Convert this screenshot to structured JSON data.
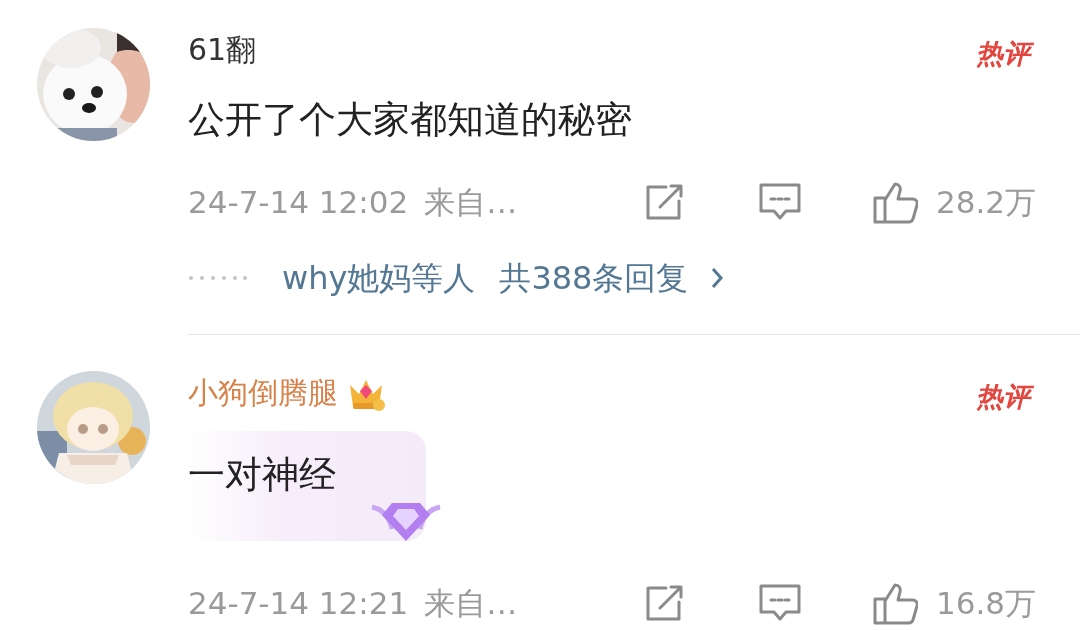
{
  "comments": [
    {
      "username": "61翻",
      "name_vip": false,
      "vip_badge": false,
      "hot_label": "热评",
      "text": "公开了个大家都知道的秘密",
      "bubble": false,
      "time": "24-7-14 12:02",
      "source": "来自…",
      "likes": "28.2万",
      "replies": {
        "names": "why她妈等人",
        "count": "共388条回复"
      }
    },
    {
      "username": "小狗倒腾腿",
      "name_vip": true,
      "vip_badge": true,
      "hot_label": "热评",
      "text": "一对神经",
      "bubble": true,
      "time": "24-7-14 12:21",
      "source": "来自…",
      "likes": "16.8万"
    }
  ]
}
